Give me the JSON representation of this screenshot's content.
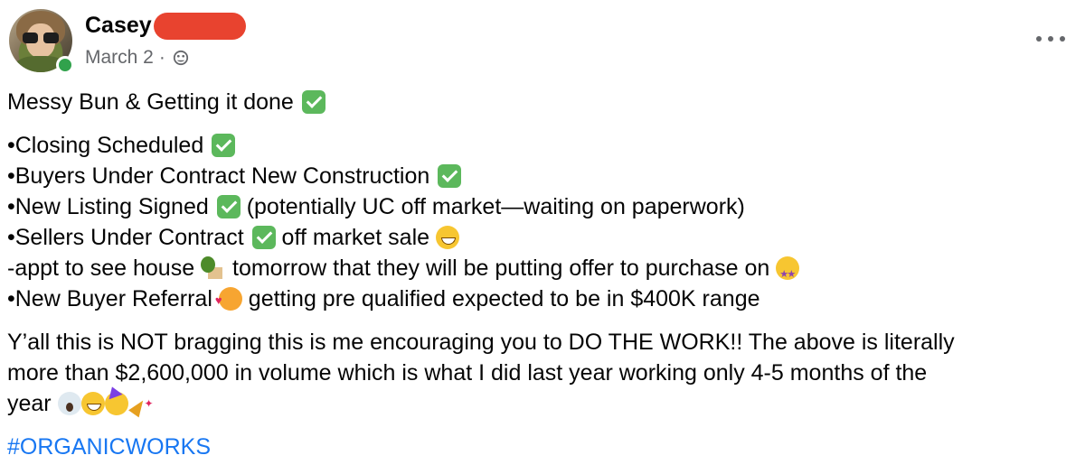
{
  "post": {
    "author": "Casey",
    "date": "March 2",
    "separator": "·",
    "privacy_icon": "group-audience-icon",
    "title_line": "Messy Bun & Getting it done",
    "bullets": {
      "b1": "•Closing Scheduled",
      "b2": "•Buyers Under Contract New Construction",
      "b3a": "•New Listing Signed",
      "b3b": "(potentially UC off market—waiting on paperwork)",
      "b4a": "•Sellers Under Contract",
      "b4b": "off market sale",
      "b5a": "-appt to see house",
      "b5b": "tomorrow that they will be putting offer to purchase on",
      "b6a": "•New Buyer Referral",
      "b6b": "getting pre qualified expected to be in $400K range"
    },
    "paragraph": {
      "p1": "Y’all this is NOT bragging this is me encouraging you to DO THE WORK!! The above is literally",
      "p2": "more than $2,600,000 in volume which is what I did last year working only 4-5 months of the",
      "p3": "year"
    },
    "hashtag": "#ORGANICWORKS"
  },
  "colors": {
    "text": "#050505",
    "meta": "#65676b",
    "link": "#1877f2",
    "check": "#5cb85c",
    "online": "#31a24c",
    "redaction": "#e8432f"
  }
}
